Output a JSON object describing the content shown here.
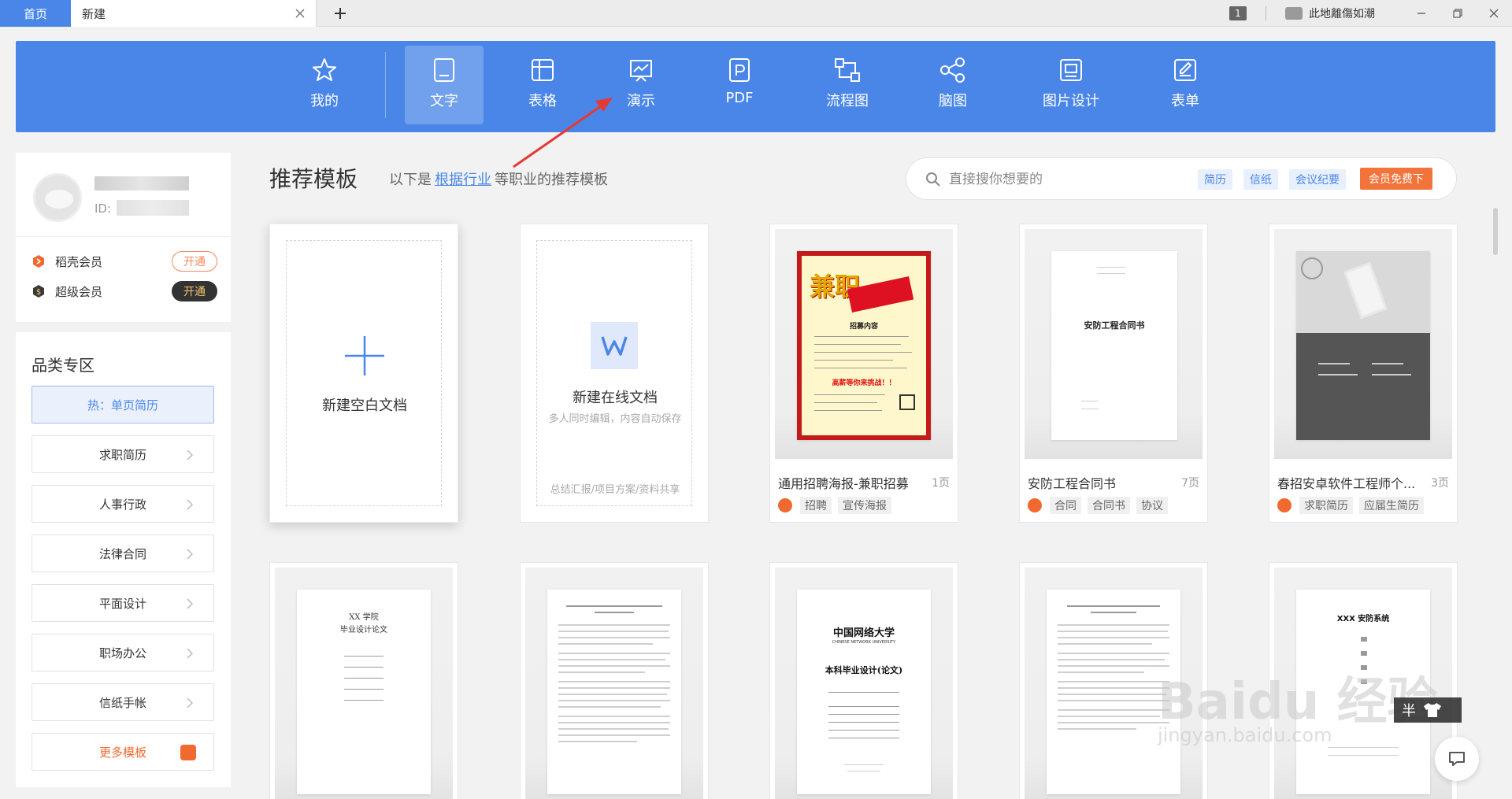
{
  "titlebar": {
    "home_tab": "首页",
    "new_tab": "新建",
    "badge": "1",
    "username": "此地離傷如潮"
  },
  "categories": [
    {
      "label": "我的",
      "icon": "star-icon"
    },
    {
      "label": "文字",
      "icon": "doc-icon",
      "active": true
    },
    {
      "label": "表格",
      "icon": "table-icon"
    },
    {
      "label": "演示",
      "icon": "presentation-icon"
    },
    {
      "label": "PDF",
      "icon": "pdf-icon"
    },
    {
      "label": "流程图",
      "icon": "flowchart-icon"
    },
    {
      "label": "脑图",
      "icon": "mindmap-icon"
    },
    {
      "label": "图片设计",
      "icon": "image-design-icon"
    },
    {
      "label": "表单",
      "icon": "form-icon"
    }
  ],
  "profile": {
    "id_label": "ID:",
    "members": [
      {
        "name": "稻壳会员",
        "action": "开通"
      },
      {
        "name": "超级会员",
        "action": "开通"
      }
    ]
  },
  "category_zone": {
    "title": "品类专区",
    "items": [
      "热：单页简历",
      "求职简历",
      "人事行政",
      "法律合同",
      "平面设计",
      "职场办公",
      "信纸手帐",
      "更多模板"
    ]
  },
  "recommend": {
    "title": "推荐模板",
    "desc_prefix": "以下是",
    "desc_link": "根据行业",
    "desc_suffix": "等职业的推荐模板"
  },
  "search": {
    "placeholder": "直接搜你想要的",
    "tags": [
      "简历",
      "信纸",
      "会议纪要"
    ],
    "vip_button": "会员免费下"
  },
  "new_blank": {
    "label": "新建空白文档"
  },
  "new_online": {
    "label": "新建在线文档",
    "sub": "多人同时编辑，内容自动保存",
    "footer": "总结汇报/项目方案/资料共享"
  },
  "templates": [
    {
      "name": "通用招聘海报-兼职招募",
      "pages": "1页",
      "tags": [
        "招聘",
        "宣传海报"
      ]
    },
    {
      "name": "安防工程合同书",
      "pages": "7页",
      "tags": [
        "合同",
        "合同书",
        "协议"
      ]
    },
    {
      "name": "春招安卓软件工程师个...",
      "pages": "3页",
      "tags": [
        "求职简历",
        "应届生简历"
      ]
    }
  ],
  "thumbnails": {
    "poster": {
      "headline": "兼职",
      "sub": "招募内容",
      "call": "高薪等你来挑战！！"
    },
    "contract": {
      "title": "安防工程合同书"
    },
    "thesis1": {
      "title": "XX 学院",
      "subtitle": "毕业设计论文"
    },
    "thesis3": {
      "school": "中国网络大学",
      "school_en": "CHINESE NETWORK UNIVERSITY",
      "title": "本科毕业设计(论文)"
    },
    "thesis5": {
      "title": "XXX 安防系统"
    }
  },
  "watermark": {
    "brand": "Baidu 经验",
    "url": "jingyan.baidu.com",
    "half_button": "半"
  },
  "colors": {
    "accent": "#4a86e8",
    "orange": "#f06a2f",
    "active_tab": "rgba(255,255,255,0.22)"
  }
}
